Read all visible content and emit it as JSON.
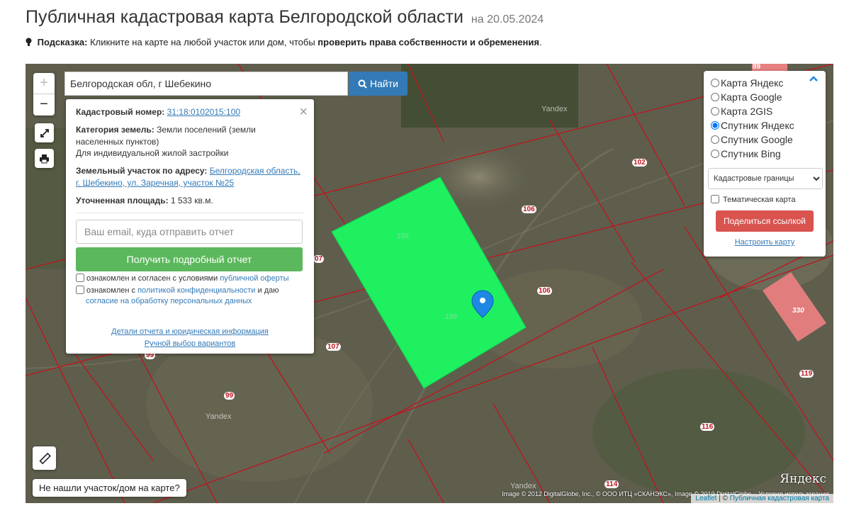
{
  "header": {
    "title": "Публичная кадастровая карта Белгородской области",
    "date": "на 20.05.2024",
    "hint_label": "Подсказка:",
    "hint_text": "Кликните на карте на любой участок или дом, чтобы",
    "hint_bold": "проверить права собственности и обременения",
    "hint_end": "."
  },
  "search": {
    "value": "Белгородская обл, г Шебекино",
    "button_label": "Найти"
  },
  "zoom": {
    "in_label": "+",
    "out_label": "−"
  },
  "info_panel": {
    "cad_label": "Кадастровый номер:",
    "cad_number": "31:18:0102015:100",
    "category_label": "Категория земель:",
    "category_value": "Земли поселений (земли населенных пунктов)",
    "usage": "Для индивидуальной жилой застройки",
    "address_label": "Земельный участок по адресу:",
    "address_value": "Белгородская область, г. Шебекино, ул. Заречная, участок №25",
    "area_label": "Уточненная площадь:",
    "area_value": "1 533 кв.м.",
    "email_placeholder": "Ваш email, куда отправить отчет",
    "report_button": "Получить подробный отчет",
    "consent1_text": "ознакомлен и согласен с условиями",
    "consent1_link": "публичной оферты",
    "consent2_text": "ознакомлен с",
    "consent2_link": "политикой конфиденциальности",
    "consent2_mid": "и даю",
    "consent2_link2": "согласие на обработку персональных данных",
    "details_link": "Детали отчета и юридическая информация",
    "manual_link": "Ручной выбор вариантов",
    "close_label": "×"
  },
  "layers": {
    "options": [
      {
        "label": "Карта Яндекс",
        "checked": false
      },
      {
        "label": "Карта Google",
        "checked": false
      },
      {
        "label": "Карта 2GIS",
        "checked": false
      },
      {
        "label": "Спутник Яндекс",
        "checked": true
      },
      {
        "label": "Спутник Google",
        "checked": false
      },
      {
        "label": "Спутник Bing",
        "checked": false
      }
    ],
    "select_value": "Кадастровые границы",
    "thematic_label": "Тематическая карта",
    "share_button": "Поделиться ссылкой",
    "setup_link": "Настроить карту"
  },
  "map": {
    "parcel_labels": {
      "l89": "89",
      "l102": "102",
      "l106a": "106",
      "l106b": "106",
      "l107a": "07",
      "l107b": "107",
      "l99a": "99",
      "l99b": "99",
      "l100a": "100",
      "l100b": "100",
      "l330": "330",
      "l119": "119",
      "l116": "116",
      "l114": "114"
    },
    "not_found_label": "Не нашли участок/дом на карте?",
    "attribution": "Image © 2012 DigitalGlobe, Inc., © ООО ИТЦ «СКАНЭКС», Image © 2019 DigitalGlobe... Условия использования",
    "leaflet_link": "Leaflet",
    "leaflet_sep": "| ©",
    "leaflet_source": "Публичная кадастровая карта",
    "yandex_logo": "Яндекс",
    "watermark": "Yandex"
  },
  "colors": {
    "selected_parcel": "#1ff060",
    "highlight_parcel": "#e88080",
    "boundary": "#c0141e",
    "primary": "#337ab7",
    "success": "#5cb85c",
    "danger": "#d9534f"
  }
}
